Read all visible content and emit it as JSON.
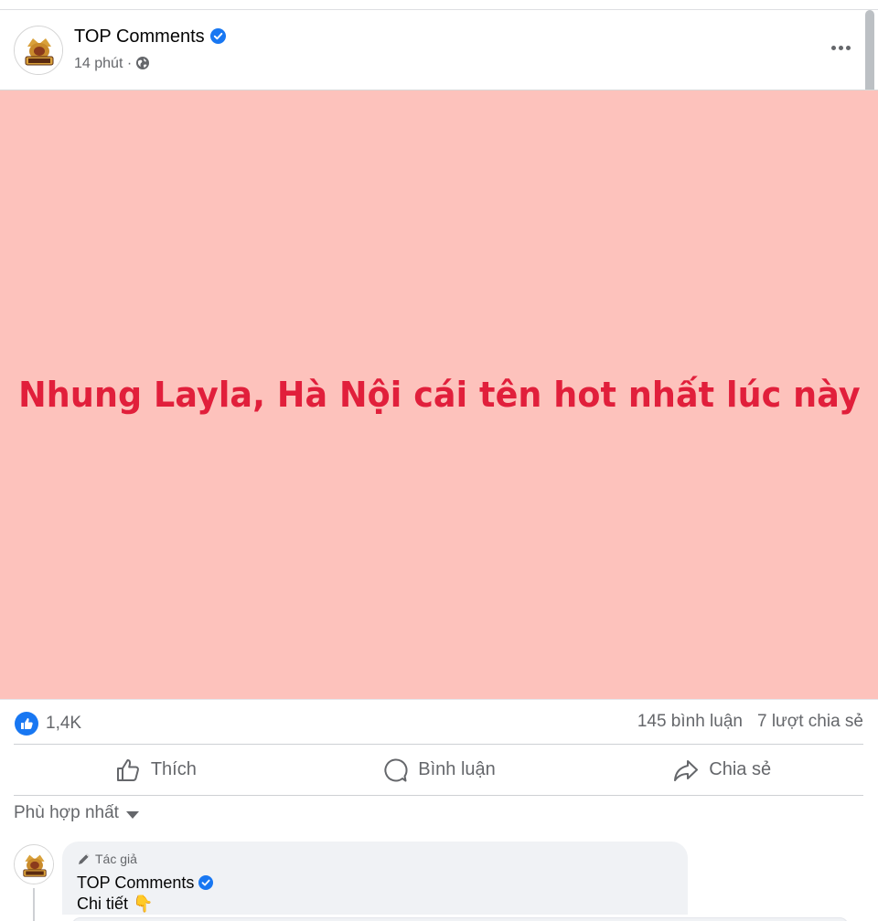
{
  "post": {
    "page_name": "TOP Comments",
    "time": "14 phút",
    "separator": "·",
    "image_text": "Nhung Layla, Hà Nội cái tên hot nhất lúc này"
  },
  "stats": {
    "reactions": "1,4K",
    "comments": "145 bình luận",
    "shares": "7 lượt chia sẻ"
  },
  "actions": {
    "like": "Thích",
    "comment": "Bình luận",
    "share": "Chia sẻ"
  },
  "sort": {
    "label": "Phù hợp nhất"
  },
  "comment": {
    "badge": "Tác giả",
    "name": "TOP Comments",
    "text": "Chi tiết 👇"
  },
  "colors": {
    "accent": "#1877f2",
    "image_bg": "#fdc2bc",
    "image_text": "#e11f3b"
  }
}
